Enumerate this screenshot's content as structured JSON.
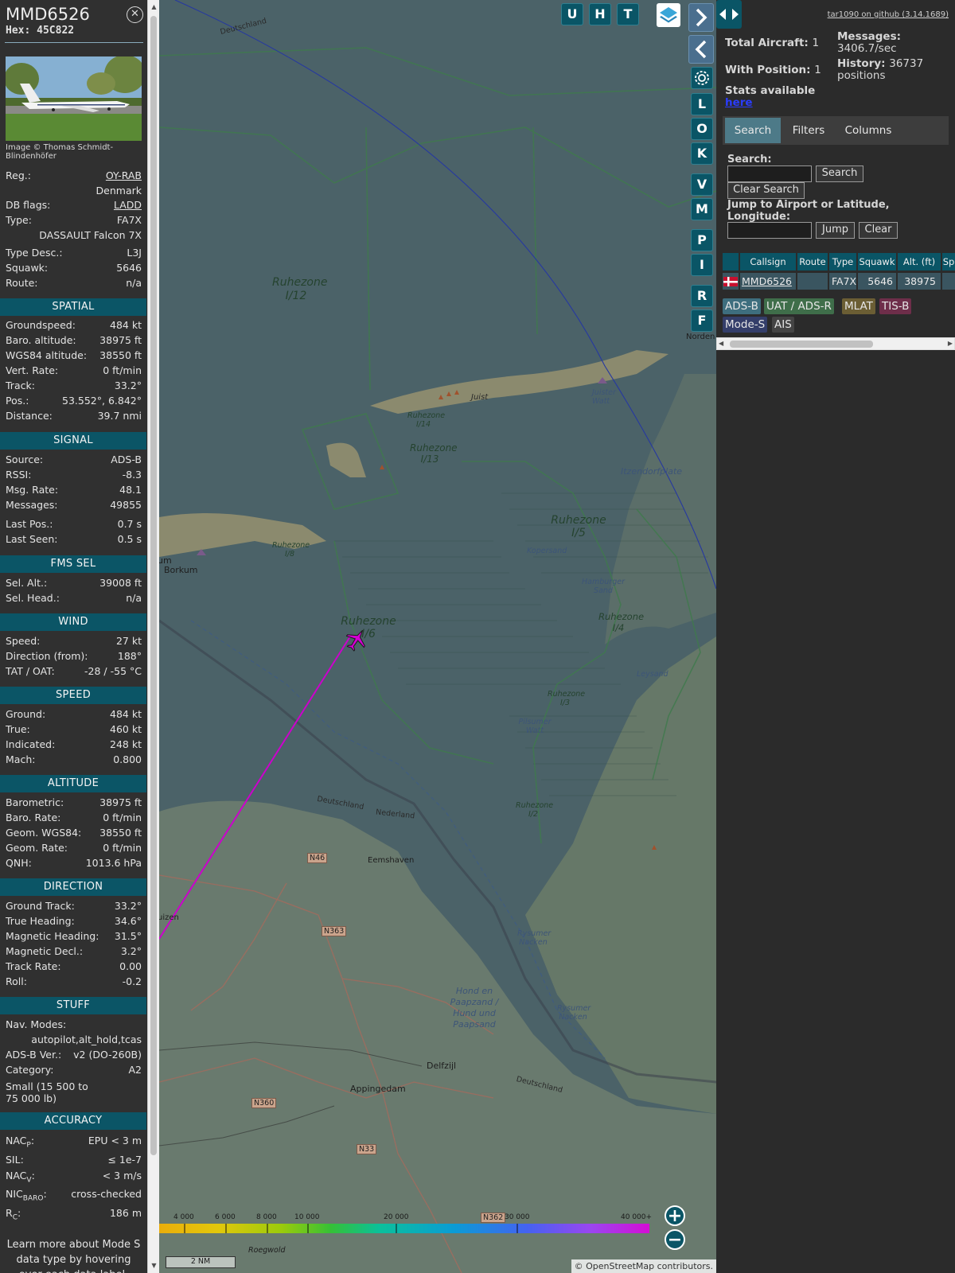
{
  "aircraft": {
    "callsign": "MMD6526",
    "hex_label": "Hex:",
    "hex": "45C822",
    "photo_credit": "Image © Thomas Schmidt-Blindenhöfer"
  },
  "info_rows": [
    {
      "label": "Reg.:",
      "value": "OY-RAB"
    },
    {
      "label": "",
      "value": "Denmark"
    },
    {
      "label": "DB flags:",
      "value": "LADD"
    },
    {
      "label": "Type:",
      "value": "FA7X"
    },
    {
      "label": "",
      "value": "DASSAULT Falcon 7X"
    },
    {
      "label": "Type Desc.:",
      "value": "L3J"
    },
    {
      "label": "Squawk:",
      "value": "5646"
    },
    {
      "label": "Route:",
      "value": "n/a"
    }
  ],
  "sections": {
    "spatial": {
      "title": "SPATIAL",
      "rows": [
        {
          "label": "Groundspeed:",
          "value": "484 kt"
        },
        {
          "label": "Baro. altitude:",
          "value": "38975 ft"
        },
        {
          "label": "WGS84 altitude:",
          "value": "38550 ft"
        },
        {
          "label": "Vert. Rate:",
          "value": "0 ft/min"
        },
        {
          "label": "Track:",
          "value": "33.2°"
        },
        {
          "label": "Pos.:",
          "value": "53.552°, 6.842°"
        },
        {
          "label": "Distance:",
          "value": "39.7 nmi"
        }
      ]
    },
    "signal": {
      "title": "SIGNAL",
      "rows": [
        {
          "label": "Source:",
          "value": "ADS-B"
        },
        {
          "label": "RSSI:",
          "value": "-8.3"
        },
        {
          "label": "Msg. Rate:",
          "value": "48.1"
        },
        {
          "label": "Messages:",
          "value": "49855"
        },
        {
          "label": "Last Pos.:",
          "value": "0.7 s"
        },
        {
          "label": "Last Seen:",
          "value": "0.5 s"
        }
      ]
    },
    "fms": {
      "title": "FMS SEL",
      "rows": [
        {
          "label": "Sel. Alt.:",
          "value": "39008 ft"
        },
        {
          "label": "Sel. Head.:",
          "value": "n/a"
        }
      ]
    },
    "wind": {
      "title": "WIND",
      "rows": [
        {
          "label": "Speed:",
          "value": "27 kt"
        },
        {
          "label": "Direction (from):",
          "value": "188°"
        },
        {
          "label": "TAT / OAT:",
          "value": "-28 / -55 °C"
        }
      ]
    },
    "speed": {
      "title": "SPEED",
      "rows": [
        {
          "label": "Ground:",
          "value": "484 kt"
        },
        {
          "label": "True:",
          "value": "460 kt"
        },
        {
          "label": "Indicated:",
          "value": "248 kt"
        },
        {
          "label": "Mach:",
          "value": "0.800"
        }
      ]
    },
    "altitude": {
      "title": "ALTITUDE",
      "rows": [
        {
          "label": "Barometric:",
          "value": "38975 ft"
        },
        {
          "label": "Baro. Rate:",
          "value": "0 ft/min"
        },
        {
          "label": "Geom. WGS84:",
          "value": "38550 ft"
        },
        {
          "label": "Geom. Rate:",
          "value": "0 ft/min"
        },
        {
          "label": "QNH:",
          "value": "1013.6 hPa"
        }
      ]
    },
    "direction": {
      "title": "DIRECTION",
      "rows": [
        {
          "label": "Ground Track:",
          "value": "33.2°"
        },
        {
          "label": "True Heading:",
          "value": "34.6°"
        },
        {
          "label": "Magnetic Heading:",
          "value": "31.5°"
        },
        {
          "label": "Magnetic Decl.:",
          "value": "3.2°"
        },
        {
          "label": "Track Rate:",
          "value": "0.00"
        },
        {
          "label": "Roll:",
          "value": "-0.2"
        }
      ]
    },
    "stuff": {
      "title": "STUFF",
      "nav_modes_label": "Nav. Modes:",
      "nav_modes_value": "autopilot,alt_hold,tcas",
      "adsb_label": "ADS-B Ver.:",
      "adsb_value": "v2 (DO-260B)",
      "category_label": "Category:",
      "category_value": "A2",
      "category_desc": "Small (15 500 to 75 000 lb)"
    },
    "accuracy": {
      "title": "ACCURACY",
      "nacp_label": "NAC",
      "nacp_sub": "P",
      "nacp_value": "EPU < 3 m",
      "sil_label": "SIL:",
      "sil_value": "≤ 1e-7",
      "nacv_label": "NAC",
      "nacv_sub": "V",
      "nacv_value": "< 3 m/s",
      "nicbaro_label": "NIC",
      "nicbaro_sub": "BARO",
      "nicbaro_value": "cross-checked",
      "rc_label": "R",
      "rc_sub": "C",
      "rc_value": "186 m"
    }
  },
  "learn_more": "Learn more about Mode S data type by hovering over each data label.",
  "map": {
    "top_buttons": [
      "U",
      "H",
      "T"
    ],
    "side_buttons": [
      "L",
      "O",
      "K",
      "V",
      "M",
      "P",
      "I",
      "R",
      "F"
    ],
    "labels": {
      "ruhezone_112": "Ruhezone I/12",
      "ruhezone_114": "Ruhezone I/14",
      "ruhezone_113": "Ruhezone I/13",
      "ruhezone_18": "Ruhezone I/8",
      "ruhezone_15": "Ruhezone I/5",
      "ruhezone_16": "Ruhezone I/6",
      "ruhezone_14": "Ruhezone I/4",
      "ruhezone_13": "Ruhezone I/3",
      "ruhezone_12": "Ruhezone I/2",
      "juist": "Juist",
      "juister_watt": "Juister Watt",
      "borkum": "Borkum",
      "itzendorfplate": "Itzendorfplate",
      "kopersand": "Kopersand",
      "hamburger_sand": "Hamburger Sand",
      "leysand": "Leysand",
      "pilsumer_watt": "Pilsumer Watt",
      "eemshaven": "Eemshaven",
      "delfzijl": "Delfzijl",
      "appingedam": "Appingedam",
      "rysumer_nacken": "Rysumer Nacken",
      "hond_paapsand": "Hond en Paapzand / Hund und Paapsand",
      "deutschland_top": "Deutschland",
      "deutschland_mid": "Deutschland",
      "nederland": "Nederland",
      "deutschland_right": "Deutschland",
      "norden": "Norden",
      "roegwold": "Roegwold",
      "uizen": "uizen",
      "um": "um",
      "road_n46": "N46",
      "road_n363": "N363",
      "road_n360": "N360",
      "road_n33": "N33",
      "road_n362": "N362"
    },
    "legend": [
      "4 000",
      "6 000",
      "8 000",
      "10 000",
      "20 000",
      "30 000",
      "40 000+"
    ],
    "scale": "2 NM",
    "attribution": "© OpenStreetMap contributors."
  },
  "stats": {
    "github": "tar1090 on github (3.14.1689)",
    "total_label": "Total Aircraft:",
    "total_value": "1",
    "position_label": "With Position:",
    "position_value": "1",
    "messages_label": "Messages:",
    "messages_value": "3406.7/sec",
    "history_label": "History:",
    "history_value": "36737",
    "history_unit": "positions",
    "stats_text": "Stats available",
    "stats_link": "here"
  },
  "tabs": [
    "Search",
    "Filters",
    "Columns"
  ],
  "search": {
    "label": "Search:",
    "search_button": "Search",
    "clear_search_button": "Clear Search",
    "jump_label": "Jump to Airport or Latitude, Longitude:",
    "jump_button": "Jump",
    "clear_button": "Clear"
  },
  "table": {
    "columns": [
      "",
      "Callsign",
      "Route",
      "Type",
      "Squawk",
      "Alt. (ft)",
      "Sp"
    ],
    "row": {
      "callsign": "MMD6526",
      "route": "",
      "type": "FA7X",
      "squawk": "5646",
      "alt": "38975"
    }
  },
  "source_badges": [
    "ADS-B",
    "UAT / ADS-R",
    "MLAT",
    "TIS-B",
    "Mode-S",
    "AIS"
  ],
  "colors": {
    "accent": "#0a5566",
    "track": "#cc00cc",
    "aircraft": "#d400d4",
    "map_water": "#4b6268"
  }
}
